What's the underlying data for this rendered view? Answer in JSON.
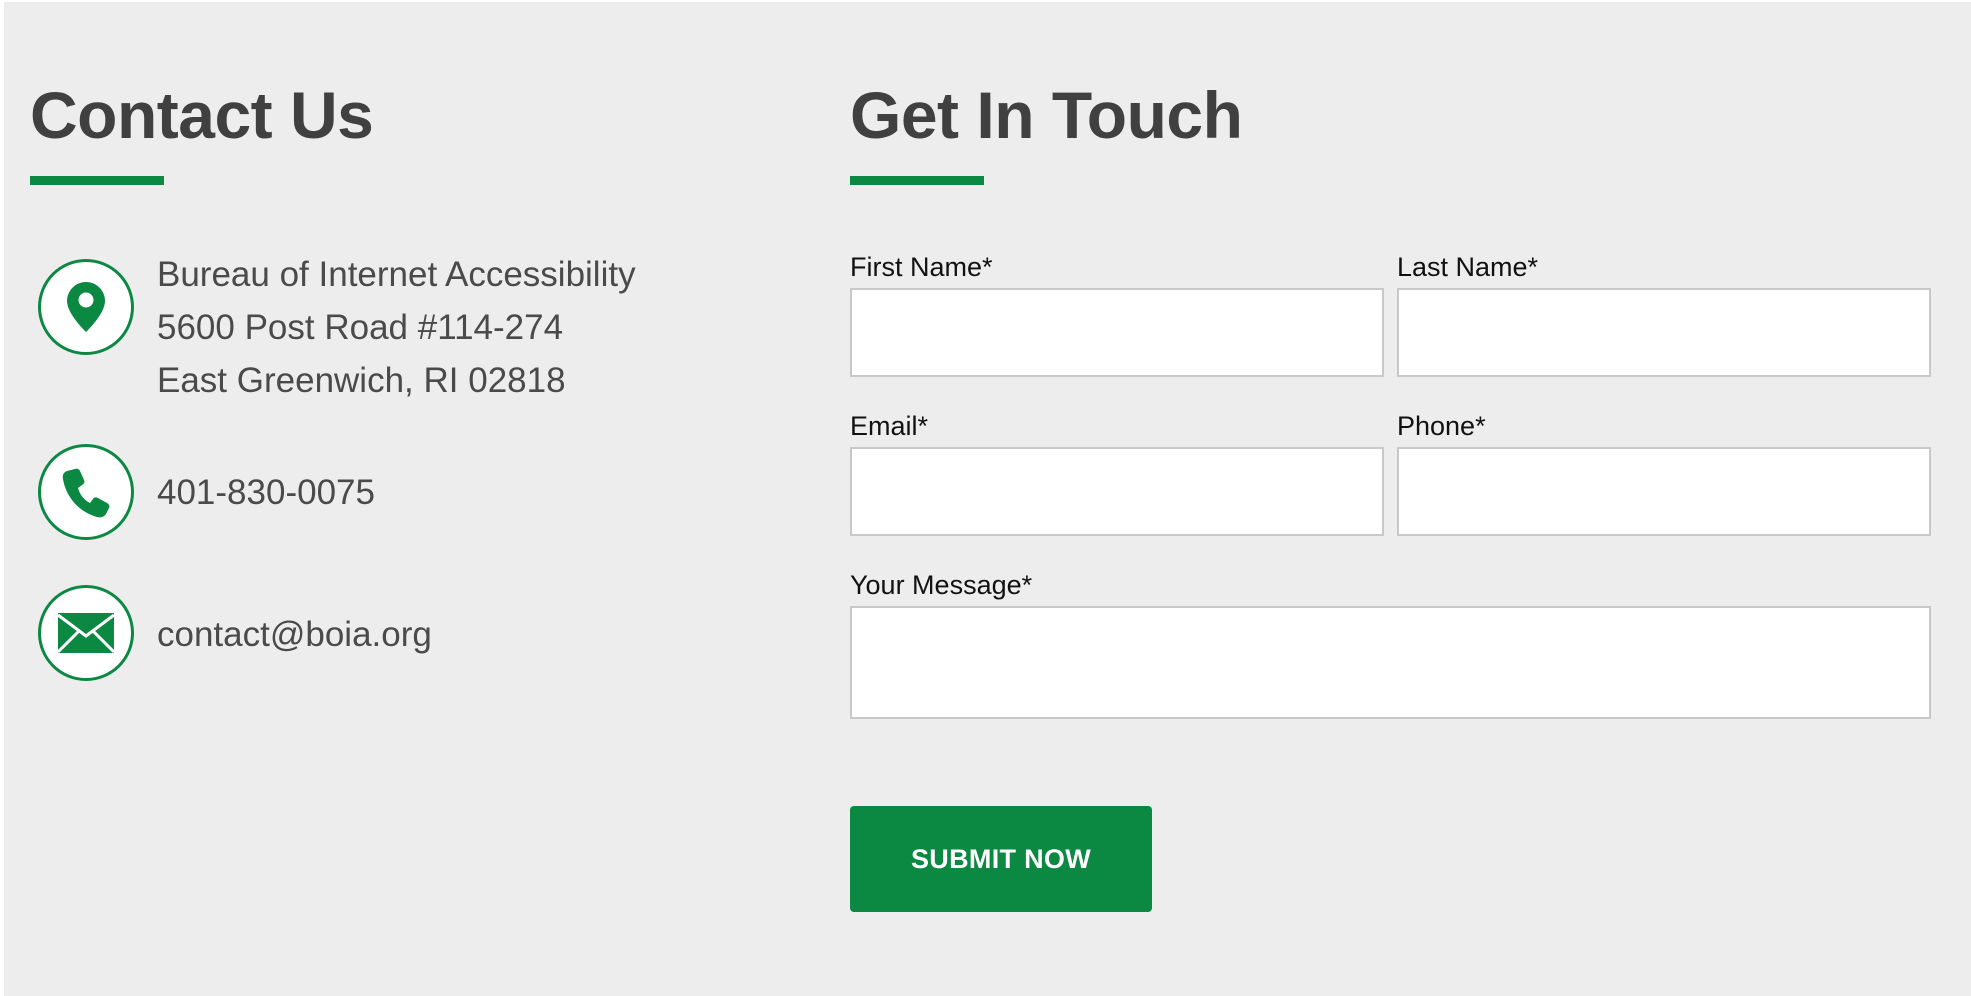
{
  "contact": {
    "title": "Contact Us",
    "address_lines": [
      "Bureau of Internet Accessibility",
      "5600 Post Road #114-274",
      "East Greenwich, RI 02818"
    ],
    "phone": "401-830-0075",
    "email": "contact@boia.org",
    "icons": [
      "map-pin-icon",
      "phone-icon",
      "envelope-icon"
    ]
  },
  "form": {
    "title": "Get In Touch",
    "first_name_label": "First Name*",
    "last_name_label": "Last Name*",
    "email_label": "Email*",
    "phone_label": "Phone*",
    "message_label": "Your Message*",
    "first_name_value": "",
    "last_name_value": "",
    "email_value": "",
    "phone_value": "",
    "message_value": "",
    "submit_label": "SUBMIT NOW"
  },
  "colors": {
    "accent": "#0b8842",
    "background": "#ededed",
    "heading": "#404040",
    "body_text": "#4a4a4a"
  }
}
